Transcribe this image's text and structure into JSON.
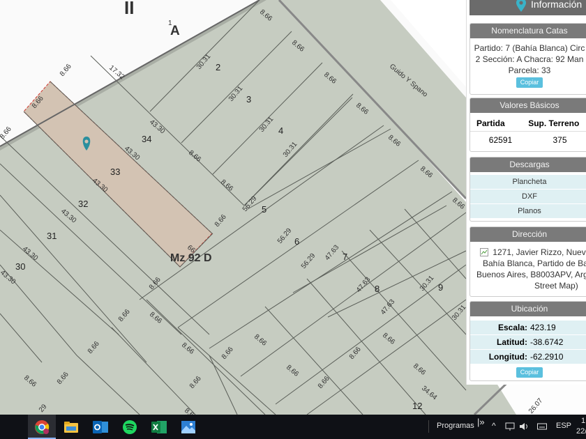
{
  "map": {
    "block_letter": "A",
    "block_letter_index": "1",
    "roman": "II",
    "street_name": "Guido Y Spano",
    "manzana_label": "Mz 92 D",
    "lot_numbers": [
      "2",
      "3",
      "4",
      "5",
      "6",
      "7",
      "8",
      "9",
      "12",
      "30",
      "31",
      "32",
      "33",
      "34"
    ],
    "dims": {
      "d866": "8.66",
      "d1732": "17.32",
      "d3031": "30.31",
      "d4330": "43.30",
      "d5629": "56.29",
      "d4763": "47.63",
      "d3464": "34.64",
      "d2607": "26.07",
      "d29": "29",
      "d66": "66"
    },
    "selected_lot_color": "#d4c2b2",
    "selected_lot_border": "#d0342c"
  },
  "panel": {
    "header": "Información",
    "nomenclatura": {
      "title": "Nomenclatura Catas",
      "line1": "Partido: 7 (Bahía Blanca) Circ",
      "line2": "2 Sección: A Chacra: 92 Man",
      "line3": "Parcela: 33",
      "copy_label": "Copiar"
    },
    "valores": {
      "title": "Valores Básicos",
      "col1": "Partida",
      "col2": "Sup. Terreno",
      "val1": "62591",
      "val2": "375"
    },
    "descargas": {
      "title": "Descargas",
      "items": [
        "Plancheta",
        "DXF",
        "Planos"
      ]
    },
    "direccion": {
      "title": "Dirección",
      "line1": "1271, Javier Rizzo, Nuev",
      "line2": "Bahía Blanca, Partido de Ba",
      "line3": "Buenos Aires, B8003APV, Arg",
      "line4": "Street Map)"
    },
    "ubicacion": {
      "title": "Ubicación",
      "escala_label": "Escala:",
      "escala_value": "423.19",
      "latitud_label": "Latitud:",
      "latitud_value": "-38.6742",
      "longitud_label": "Longitud:",
      "longitud_value": "-62.2910",
      "copy_label": "Copiar"
    }
  },
  "taskbar": {
    "apps": [
      "chrome-icon",
      "file-explorer-icon",
      "outlook-icon",
      "spotify-icon",
      "excel-icon",
      "photos-icon"
    ],
    "programas_label": "Programas",
    "language": "ESP",
    "clock_top": "1",
    "clock_bottom": "22/"
  }
}
